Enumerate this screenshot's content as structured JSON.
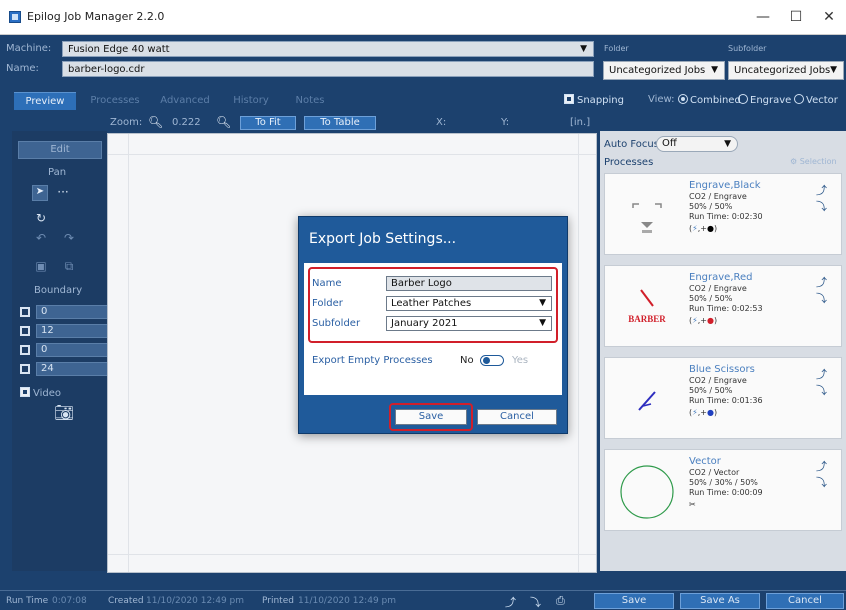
{
  "window": {
    "title": "Epilog Job Manager 2.2.0",
    "minimize": "—",
    "maximize": "☐",
    "close": "✕"
  },
  "job": {
    "machine_label": "Machine:",
    "machine_value": "Fusion Edge 40 watt",
    "name_label": "Name:",
    "name_value": "barber-logo.cdr",
    "folder_label": "Folder",
    "folder_value": "Uncategorized Jobs",
    "subfolder_label": "Subfolder",
    "subfolder_value": "Uncategorized Jobs"
  },
  "tabs": [
    {
      "label": "Preview"
    },
    {
      "label": "Processes"
    },
    {
      "label": "Advanced"
    },
    {
      "label": "History"
    },
    {
      "label": "Notes"
    }
  ],
  "view": {
    "snapping_label": "Snapping",
    "view_label": "View:",
    "combined_label": "Combined",
    "engrave_label": "Engrave",
    "vector_label": "Vector"
  },
  "zoom": {
    "label": "Zoom:",
    "value": "0.222",
    "to_fit": "To Fit",
    "to_table": "To Table",
    "x_label": "X:",
    "y_label": "Y:",
    "unit": "[in.]"
  },
  "left_panel": {
    "edit": "Edit",
    "pan": "Pan",
    "boundary": "Boundary",
    "boundary_values": [
      "0",
      "12",
      "0",
      "24"
    ],
    "video": "Video"
  },
  "right_panel": {
    "auto_focus_label": "Auto Focus",
    "auto_focus_value": "Off",
    "processes_label": "Processes",
    "selection_label": "Selection",
    "processes": [
      {
        "name": "Engrave,Black",
        "lines": [
          "CO2 / Engrave",
          "50% / 50%",
          "Run Time: 0:02:30"
        ],
        "accent": "#000000"
      },
      {
        "name": "Engrave,Red",
        "lines": [
          "CO2 / Engrave",
          "50% / 50%",
          "Run Time: 0:02:53"
        ],
        "accent": "#d11f2a"
      },
      {
        "name": "Blue Scissors",
        "lines": [
          "CO2 / Engrave",
          "50% / 50%",
          "Run Time: 0:01:36"
        ],
        "accent": "#1f3fbf"
      },
      {
        "name": "Vector",
        "lines": [
          "CO2 / Vector",
          "50% / 30% / 50%",
          "Run Time: 0:00:09"
        ],
        "accent": "#2e9a4a"
      }
    ],
    "thumb_text_barber": "BARBER"
  },
  "status": {
    "run_time_label": "Run Time",
    "run_time_value": "0:07:08",
    "created_label": "Created",
    "created_value": "11/10/2020 12:49 pm",
    "printed_label": "Printed",
    "printed_value": "11/10/2020 12:49 pm",
    "save": "Save",
    "save_as": "Save As",
    "cancel": "Cancel"
  },
  "dialog": {
    "title": "Export Job Settings...",
    "name_label": "Name",
    "name_value": "Barber Logo",
    "folder_label": "Folder",
    "folder_value": "Leather Patches",
    "subfolder_label": "Subfolder",
    "subfolder_value": "January 2021",
    "export_empty_label": "Export Empty Processes",
    "no_label": "No",
    "yes_label": "Yes",
    "save": "Save",
    "cancel": "Cancel",
    "highlight_color": "#d11f2a"
  }
}
